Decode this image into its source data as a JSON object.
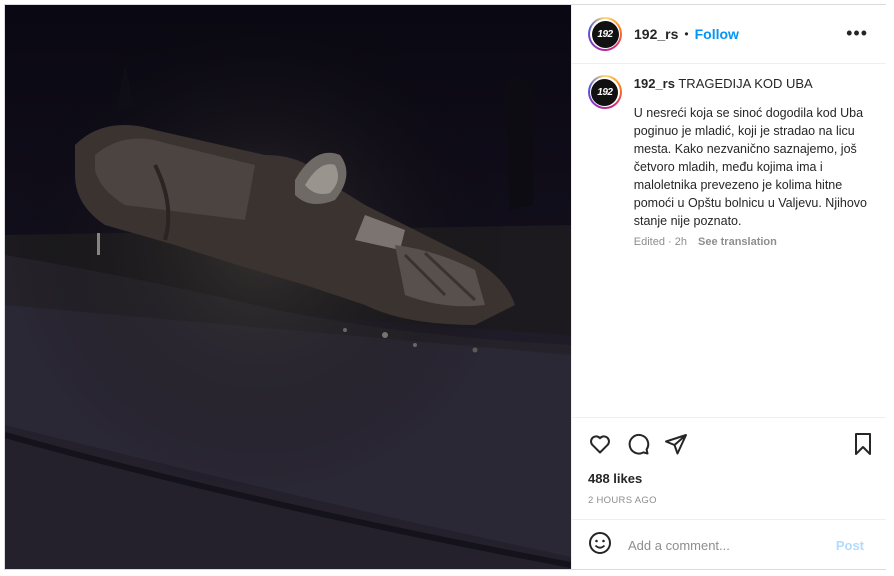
{
  "post": {
    "username": "192_rs",
    "avatar_text": "192",
    "follow_label": "Follow",
    "dot": "•",
    "more_label": "•••",
    "caption_title": "TRAGEDIJA KOD UBA",
    "caption_text": "U nesreći koja se sinoć dogodila kod Uba poginuo je mladić, koji je stradao na licu mesta. Kako nezvanično saznajemo, još četvoro mladih, među kojima ima i maloletnika prevezeno je kolima hitne pomoći u Opštu bolnicu u Valjevu. Njihovo stanje nije poznato.",
    "edited_label": "Edited · 2h",
    "see_translation": "See translation",
    "likes": "488 likes",
    "time_ago": "2 HOURS AGO",
    "comment_placeholder": "Add a comment...",
    "post_label": "Post"
  },
  "icons": {
    "like": "heart-icon",
    "comment": "comment-icon",
    "share": "send-icon",
    "save": "bookmark-icon",
    "emoji": "smiley-icon"
  },
  "colors": {
    "accent": "#0095f6",
    "post_disabled": "#b3dbff",
    "muted": "#8e8e8e",
    "text": "#262626"
  }
}
